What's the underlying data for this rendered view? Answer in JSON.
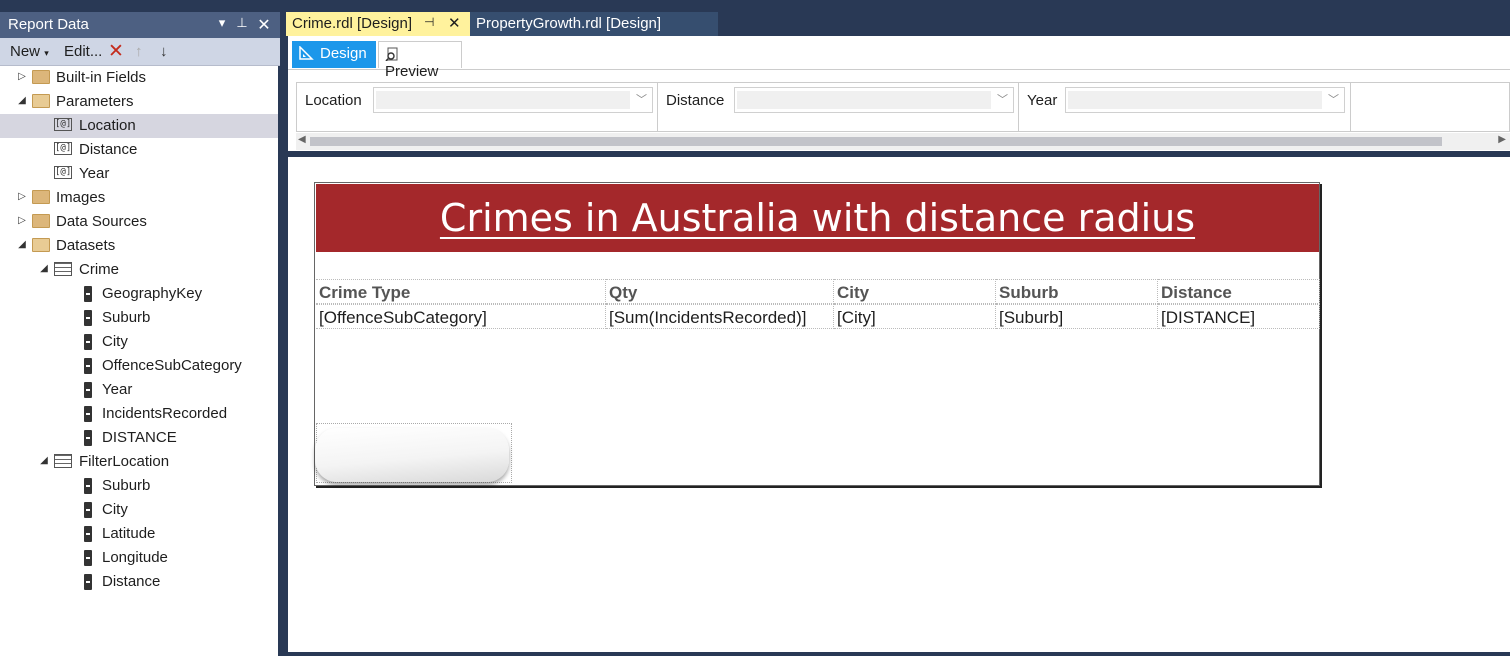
{
  "report_data_panel": {
    "title": "Report Data",
    "toolbar": {
      "new_label": "New",
      "edit_label": "Edit..."
    },
    "tree": {
      "built_in_fields": "Built-in Fields",
      "parameters": "Parameters",
      "params": [
        "Location",
        "Distance",
        "Year"
      ],
      "images": "Images",
      "data_sources": "Data Sources",
      "datasets": "Datasets",
      "crime": "Crime",
      "crime_fields": [
        "GeographyKey",
        "Suburb",
        "City",
        "OffenceSubCategory",
        "Year",
        "IncidentsRecorded",
        "DISTANCE"
      ],
      "filter_location": "FilterLocation",
      "filter_fields": [
        "Suburb",
        "City",
        "Latitude",
        "Longitude",
        "Distance"
      ]
    }
  },
  "tabs": {
    "active": "Crime.rdl [Design]",
    "other": "PropertyGrowth.rdl [Design]"
  },
  "subtabs": {
    "design": "Design",
    "preview": "Preview"
  },
  "parameters_pane": {
    "location": "Location",
    "distance": "Distance",
    "year": "Year"
  },
  "report": {
    "title": "Crimes in Australia with distance radius",
    "headers": [
      "Crime Type",
      "Qty",
      "City",
      "Suburb",
      "Distance"
    ],
    "row": [
      "[OffenceSubCategory]",
      "[Sum(IncidentsRecorded)]",
      "[City]",
      "[Suburb]",
      "[DISTANCE]"
    ],
    "title_color": "#a4282b"
  }
}
